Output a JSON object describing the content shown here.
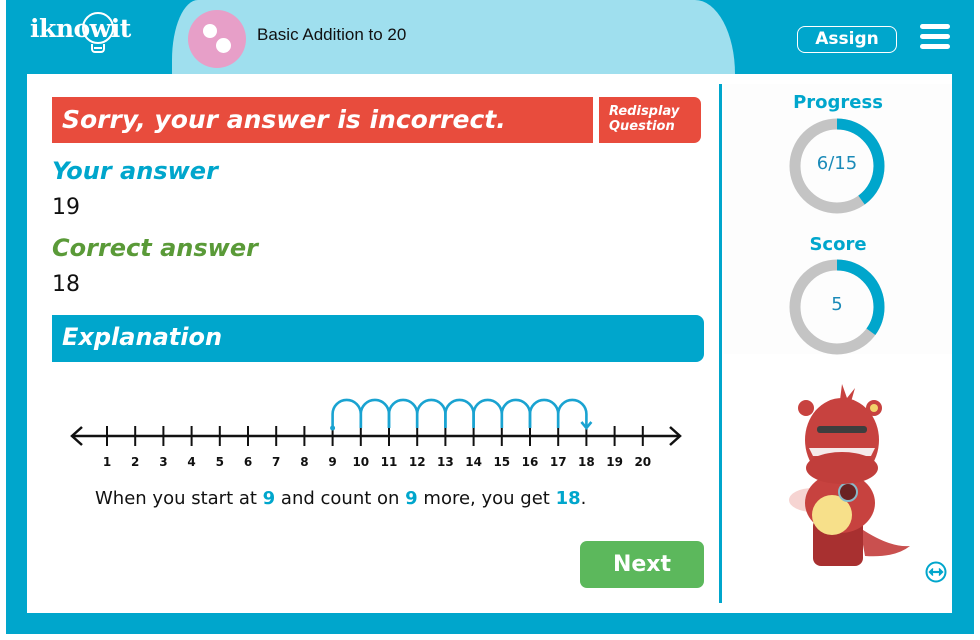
{
  "header": {
    "logo_text": "iknowit",
    "topic_title": "Basic Addition to 20",
    "assign_label": "Assign",
    "menu_icon": "hamburger-menu-icon"
  },
  "feedback": {
    "banner": "Sorry, your answer is incorrect.",
    "redisplay_line1": "Redisplay",
    "redisplay_line2": "Question",
    "your_answer_label": "Your answer",
    "your_answer_value": "19",
    "correct_answer_label": "Correct answer",
    "correct_answer_value": "18",
    "explanation_label": "Explanation"
  },
  "number_line": {
    "min": 1,
    "max": 20,
    "labels": [
      "1",
      "2",
      "3",
      "4",
      "5",
      "6",
      "7",
      "8",
      "9",
      "10",
      "11",
      "12",
      "13",
      "14",
      "15",
      "16",
      "17",
      "18",
      "19",
      "20"
    ],
    "jump_start": 9,
    "jump_end": 18,
    "jump_color": "#1aa3d1"
  },
  "explanation": {
    "part1": "When you start at ",
    "start": "9",
    "part2": " and count on ",
    "count": "9",
    "part3": " more, you get ",
    "result": "18",
    "part4": "."
  },
  "next_label": "Next",
  "sidebar": {
    "progress_label": "Progress",
    "progress_text": "6/15",
    "progress_current": 6,
    "progress_total": 15,
    "score_label": "Score",
    "score_text": "5",
    "score_fraction": 0.35
  },
  "colors": {
    "brand_teal": "#00a6cc",
    "header_tab": "#9fdfee",
    "error_red": "#e84c3d",
    "correct_green": "#5a9a38",
    "next_green": "#5cb85c",
    "ring_gray": "#c4c4c4",
    "topic_pink": "#e79fc8"
  }
}
